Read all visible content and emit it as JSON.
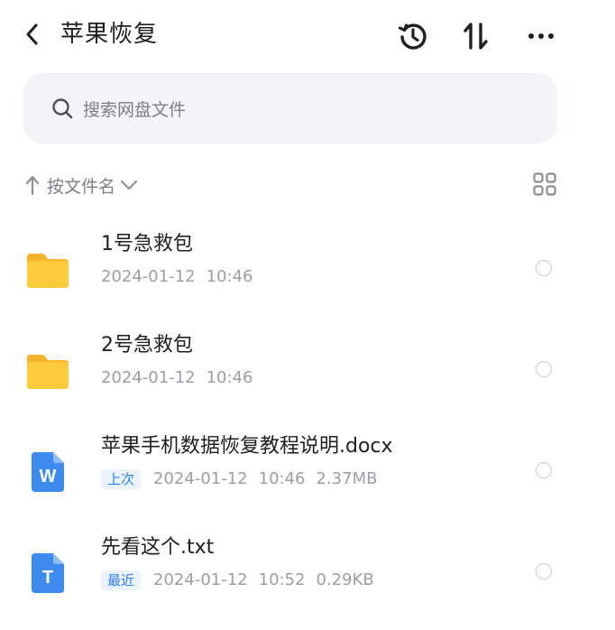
{
  "header": {
    "title": "苹果恢复",
    "icons": {
      "back": "chevron-left-icon",
      "history": "history-icon",
      "sort": "sort-arrows-icon",
      "more": "more-dots-icon"
    }
  },
  "search": {
    "placeholder": "搜索网盘文件"
  },
  "sort_bar": {
    "label": "按文件名"
  },
  "colors": {
    "folder": "#FBCB3C",
    "word": "#3E8BF0",
    "txt": "#3E8BF0",
    "badge_bg": "#EAF3FF",
    "badge_text": "#2F7CF6"
  },
  "files": [
    {
      "name": "1号急救包",
      "type": "folder",
      "date": "2024-01-12",
      "time": "10:46"
    },
    {
      "name": "2号急救包",
      "type": "folder",
      "date": "2024-01-12",
      "time": "10:46"
    },
    {
      "name": "苹果手机数据恢复教程说明.docx",
      "type": "word",
      "icon_letter": "W",
      "badge": "上次",
      "date": "2024-01-12",
      "time": "10:46",
      "size": "2.37MB"
    },
    {
      "name": "先看这个.txt",
      "type": "txt",
      "icon_letter": "T",
      "badge": "最近",
      "date": "2024-01-12",
      "time": "10:52",
      "size": "0.29KB"
    }
  ]
}
